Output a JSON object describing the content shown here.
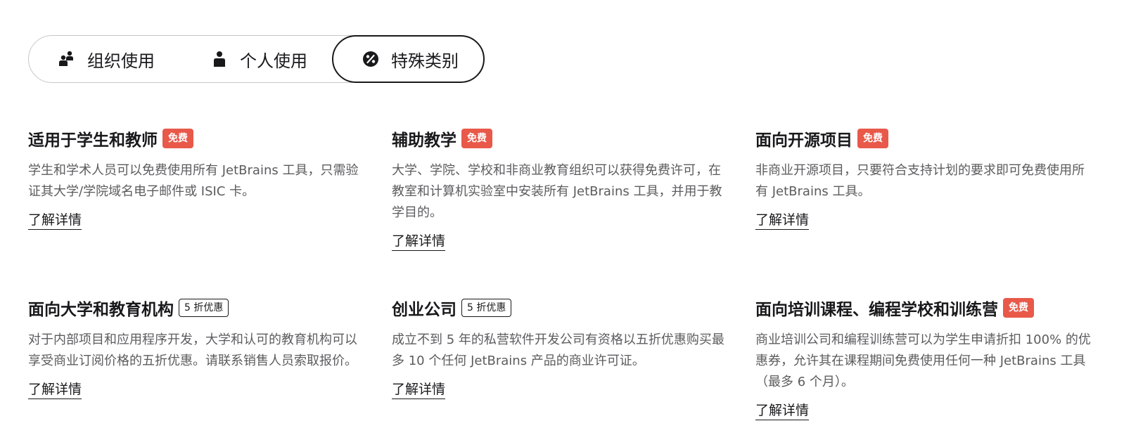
{
  "tabs": [
    {
      "label": "组织使用",
      "icon": "team-icon",
      "selected": false
    },
    {
      "label": "个人使用",
      "icon": "person-icon",
      "selected": false
    },
    {
      "label": "特殊类别",
      "icon": "percent-icon",
      "selected": true
    }
  ],
  "cards": [
    {
      "title": "适用于学生和教师",
      "badge": "免费",
      "badge_type": "free",
      "description": "学生和学术人员可以免费使用所有 JetBrains 工具，只需验证其大学/学院域名电子邮件或 ISIC 卡。",
      "link": "了解详情"
    },
    {
      "title": "辅助教学",
      "badge": "免费",
      "badge_type": "free",
      "description": "大学、学院、学校和非商业教育组织可以获得免费许可，在教室和计算机实验室中安装所有 JetBrains 工具，并用于教学目的。",
      "link": "了解详情"
    },
    {
      "title": "面向开源项目",
      "badge": "免费",
      "badge_type": "free",
      "description": "非商业开源项目，只要符合支持计划的要求即可免费使用所有 JetBrains 工具。",
      "link": "了解详情"
    },
    {
      "title": "面向大学和教育机构",
      "badge": "5 折优惠",
      "badge_type": "discount",
      "description": "对于内部项目和应用程序开发，大学和认可的教育机构可以享受商业订阅价格的五折优惠。请联系销售人员索取报价。",
      "link": "了解详情"
    },
    {
      "title": "创业公司",
      "badge": "5 折优惠",
      "badge_type": "discount",
      "description": "成立不到 5 年的私营软件开发公司有资格以五折优惠购买最多 10 个任何 JetBrains 产品的商业许可证。",
      "link": "了解详情"
    },
    {
      "title": "面向培训课程、编程学校和训练营",
      "badge": "免费",
      "badge_type": "free",
      "description": "商业培训公司和编程训练营可以为学生申请折扣 100% 的优惠券，允许其在课程期间免费使用任何一种 JetBrains 工具（最多 6 个月）。",
      "link": "了解详情"
    }
  ],
  "colors": {
    "badge_free_bg": "#e8594a",
    "text_primary": "#19191c",
    "text_secondary": "#5c5c5f"
  }
}
